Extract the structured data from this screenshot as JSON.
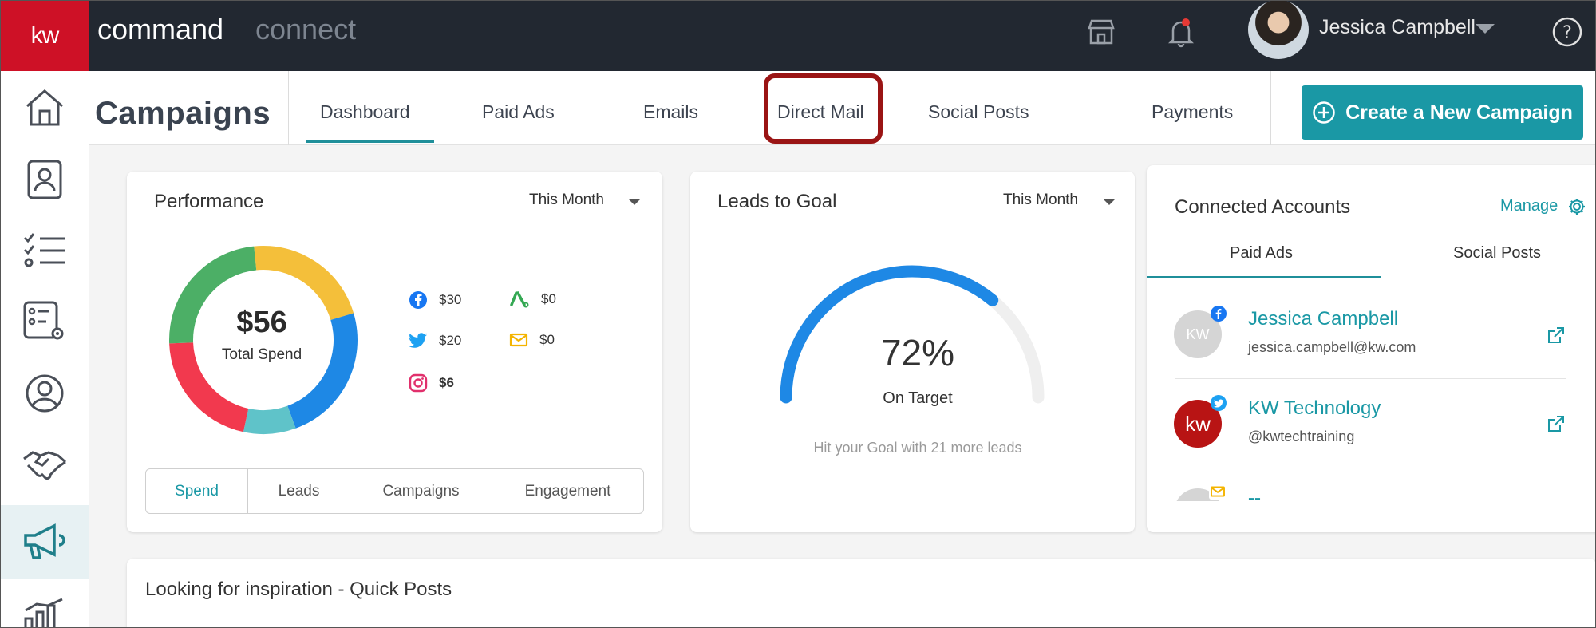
{
  "topbar": {
    "logo_text": "kw",
    "brand_primary": "command",
    "brand_secondary": "connect",
    "user_name": "Jessica Campbell",
    "icons": [
      "store-icon",
      "bell-icon",
      "help-icon"
    ]
  },
  "sidebar": {
    "items": [
      "home-icon",
      "contacts-icon",
      "tasks-icon",
      "checklist-settings-icon",
      "profile-icon",
      "handshake-icon",
      "megaphone-icon",
      "chart-icon"
    ],
    "active": "megaphone-icon"
  },
  "header": {
    "title": "Campaigns",
    "tabs": [
      {
        "label": "Dashboard"
      },
      {
        "label": "Paid Ads"
      },
      {
        "label": "Emails"
      },
      {
        "label": "Direct Mail"
      },
      {
        "label": "Social Posts"
      },
      {
        "label": "Payments"
      }
    ],
    "active_tab": "Dashboard",
    "create_button": "Create a New Campaign"
  },
  "performance": {
    "title": "Performance",
    "period": "This Month",
    "total_value": "$56",
    "total_label": "Total Spend",
    "legend": [
      {
        "icon": "facebook-icon",
        "value": "$30"
      },
      {
        "icon": "twitter-icon",
        "value": "$20"
      },
      {
        "icon": "instagram-icon",
        "value": "$6"
      },
      {
        "icon": "adwords-icon",
        "value": "$0"
      },
      {
        "icon": "mail-icon",
        "value": "$0"
      }
    ],
    "segments": [
      "Spend",
      "Leads",
      "Campaigns",
      "Engagement"
    ],
    "active_segment": "Spend"
  },
  "leads_to_goal": {
    "title": "Leads to Goal",
    "period": "This Month",
    "percent_label": "72%",
    "status": "On Target",
    "hint": "Hit your Goal with 21 more leads",
    "progress": 0.72
  },
  "connected_accounts": {
    "title": "Connected Accounts",
    "manage_label": "Manage",
    "tabs": [
      "Paid Ads",
      "Social Posts"
    ],
    "active_tab": "Paid Ads",
    "accounts": [
      {
        "name": "Jessica Campbell",
        "handle": "jessica.campbell@kw.com",
        "badge": "facebook-icon",
        "avatar_text": "KW"
      },
      {
        "name": "KW Technology",
        "handle": "@kwtechtraining",
        "badge": "twitter-icon",
        "avatar_text": "kw"
      },
      {
        "name": "--",
        "handle": "",
        "badge": "mail-icon",
        "avatar_text": ""
      }
    ]
  },
  "inspiration": {
    "title": "Looking for inspiration - Quick Posts"
  },
  "colors": {
    "brand_red": "#ce1126",
    "accent_teal": "#1a98a5",
    "highlight_box": "#9a1414",
    "donut": {
      "facebook": "#1e88e5",
      "instagram": "#5fc3c9",
      "twitter": "#f2394e",
      "other_green": "#4caf66",
      "yellow": "#f4bf3a"
    }
  }
}
